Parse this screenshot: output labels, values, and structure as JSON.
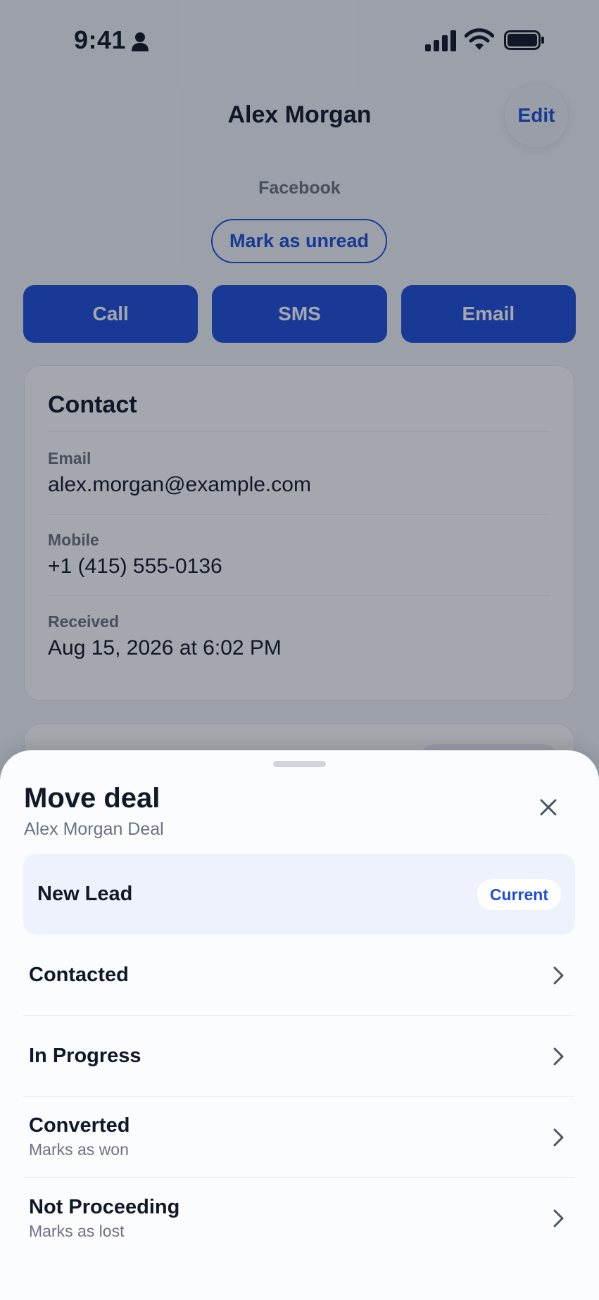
{
  "status_bar": {
    "time": "9:41",
    "icons": [
      "person-icon",
      "cellular-signal-icon",
      "wifi-icon",
      "battery-icon"
    ]
  },
  "header": {
    "title": "Alex Morgan",
    "edit_label": "Edit"
  },
  "lead": {
    "source": "Facebook",
    "mark_unread_label": "Mark as unread"
  },
  "actions": [
    {
      "label": "Call"
    },
    {
      "label": "SMS"
    },
    {
      "label": "Email"
    }
  ],
  "contact": {
    "title": "Contact",
    "fields": [
      {
        "label": "Email",
        "value": "alex.morgan@example.com"
      },
      {
        "label": "Mobile",
        "value": "+1 (415) 555-0136"
      },
      {
        "label": "Received",
        "value": "Aug 15, 2026 at 6:02 PM"
      }
    ]
  },
  "sheet": {
    "title": "Move deal",
    "subtitle": "Alex Morgan Deal",
    "close_icon": "close-icon",
    "stages": [
      {
        "name": "New Lead",
        "badge": "Current"
      },
      {
        "name": "Contacted"
      },
      {
        "name": "In Progress"
      },
      {
        "name": "Converted",
        "description": "Marks as won"
      },
      {
        "name": "Not Proceeding",
        "description": "Marks as lost"
      }
    ]
  },
  "colors": {
    "accent": "#1d4ed8",
    "text_primary": "#111827",
    "text_secondary": "#6b7280",
    "current_row_bg": "#edf2fd"
  }
}
